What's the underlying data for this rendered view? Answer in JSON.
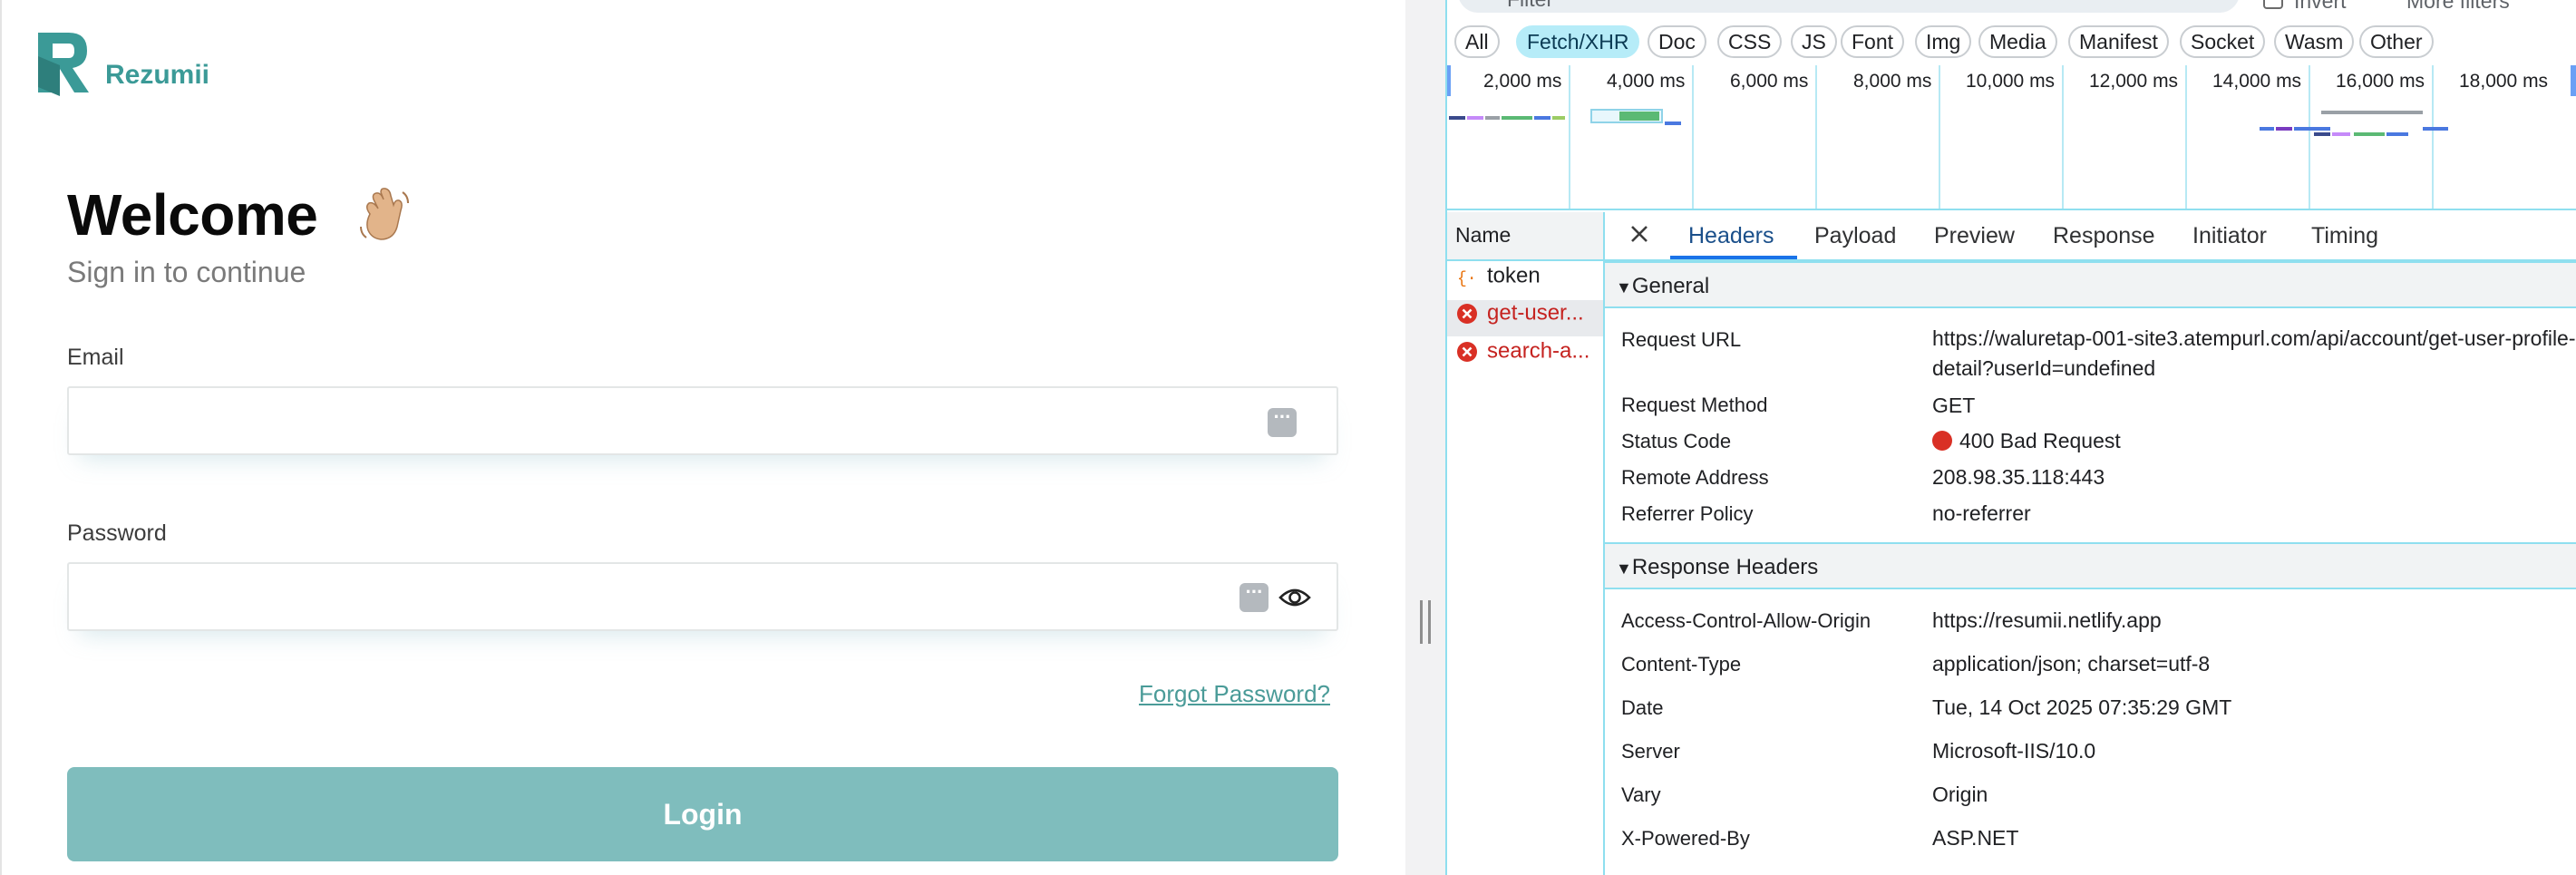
{
  "app": {
    "brand": "Rezumii",
    "welcome": "Welcome",
    "subtitle": "Sign in to continue",
    "email_label": "Email",
    "email_value": "",
    "password_label": "Password",
    "password_value": "",
    "forgot_password": "Forgot Password?",
    "login_button": "Login",
    "accent_color": "#7fbdbd"
  },
  "devtools": {
    "filter_placeholder": "Filter",
    "invert_label": "Invert",
    "more_filters_label": "More filters",
    "type_filters": [
      "All",
      "Fetch/XHR",
      "Doc",
      "CSS",
      "JS",
      "Font",
      "Img",
      "Media",
      "Manifest",
      "Socket",
      "Wasm",
      "Other"
    ],
    "active_filter": "Fetch/XHR",
    "timeline_ticks": [
      "2,000 ms",
      "4,000 ms",
      "6,000 ms",
      "8,000 ms",
      "10,000 ms",
      "12,000 ms",
      "14,000 ms",
      "16,000 ms",
      "18,000 ms"
    ],
    "name_column": "Name",
    "requests": [
      {
        "name": "token",
        "status": "ok",
        "icon": "xhr-icon"
      },
      {
        "name": "get-user...",
        "status": "error",
        "icon": "error-icon"
      },
      {
        "name": "search-a...",
        "status": "error",
        "icon": "error-icon"
      }
    ],
    "selected_request": "get-user...",
    "tabs": [
      "Headers",
      "Payload",
      "Preview",
      "Response",
      "Initiator",
      "Timing"
    ],
    "active_tab": "Headers",
    "general": {
      "title": "General",
      "request_url_label": "Request URL",
      "request_url": "https://waluretap-001-site3.atempurl.com/api/account/get-user-profile-detail?userId=undefined",
      "request_method_label": "Request Method",
      "request_method": "GET",
      "status_code_label": "Status Code",
      "status_code": "400 Bad Request",
      "remote_address_label": "Remote Address",
      "remote_address": "208.98.35.118:443",
      "referrer_policy_label": "Referrer Policy",
      "referrer_policy": "no-referrer"
    },
    "response_headers": {
      "title": "Response Headers",
      "items": [
        {
          "key": "Access-Control-Allow-Origin",
          "value": "https://resumii.netlify.app"
        },
        {
          "key": "Content-Type",
          "value": "application/json; charset=utf-8"
        },
        {
          "key": "Date",
          "value": "Tue, 14 Oct 2025 07:35:29 GMT"
        },
        {
          "key": "Server",
          "value": "Microsoft-IIS/10.0"
        },
        {
          "key": "Vary",
          "value": "Origin"
        },
        {
          "key": "X-Powered-By",
          "value": "ASP.NET"
        }
      ]
    }
  }
}
